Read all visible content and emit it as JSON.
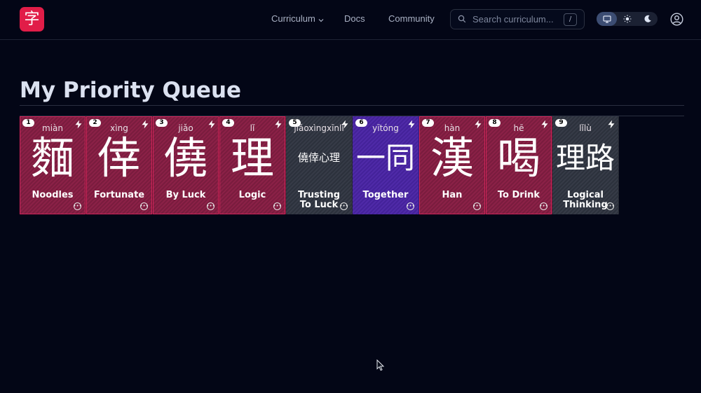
{
  "app": {
    "logo_char": "字"
  },
  "nav": {
    "curriculum": "Curriculum",
    "docs": "Docs",
    "community": "Community"
  },
  "search": {
    "placeholder": "Search curriculum...",
    "shortcut": "/"
  },
  "theme": {
    "options": [
      "desktop-icon",
      "sun-icon",
      "moon-icon"
    ],
    "active": "desktop-icon"
  },
  "page": {
    "title": "My Priority Queue"
  },
  "colors": {
    "brand": "#e11d48",
    "card_red": "#8b2147",
    "card_gray": "#363b47",
    "card_purple": "#4f2aa8",
    "background": "#030616"
  },
  "cards": [
    {
      "number": "1",
      "pinyin": "miàn",
      "hanzi": "麵",
      "meaning": "Noodles",
      "variant": "red",
      "size": "l"
    },
    {
      "number": "2",
      "pinyin": "xìng",
      "hanzi": "倖",
      "meaning": "Fortunate",
      "variant": "red",
      "size": "l"
    },
    {
      "number": "3",
      "pinyin": "jiǎo",
      "hanzi": "僥",
      "meaning": "By Luck",
      "variant": "red",
      "size": "l"
    },
    {
      "number": "4",
      "pinyin": "lǐ",
      "hanzi": "理",
      "meaning": "Logic",
      "variant": "red",
      "size": "l"
    },
    {
      "number": "5",
      "pinyin": "jiǎoxìngxīnlǐ",
      "hanzi": "僥倖心理",
      "meaning": "Trusting To Luck",
      "variant": "gray",
      "size": "s"
    },
    {
      "number": "6",
      "pinyin": "yītóng",
      "hanzi": "一同",
      "meaning": "Together",
      "variant": "purple",
      "size": "m"
    },
    {
      "number": "7",
      "pinyin": "hàn",
      "hanzi": "漢",
      "meaning": "Han",
      "variant": "red",
      "size": "l"
    },
    {
      "number": "8",
      "pinyin": "hē",
      "hanzi": "喝",
      "meaning": "To Drink",
      "variant": "red",
      "size": "l"
    },
    {
      "number": "9",
      "pinyin": "lǐlù",
      "hanzi": "理路",
      "meaning": "Logical Thinking",
      "variant": "gray",
      "size": "m"
    }
  ]
}
